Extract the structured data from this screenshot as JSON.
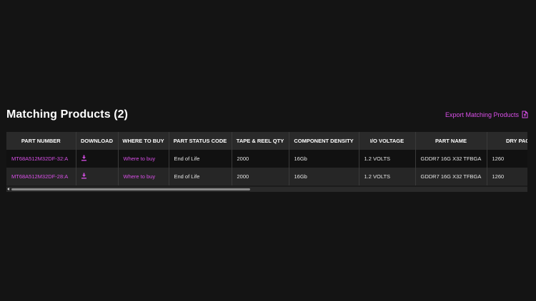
{
  "section": {
    "title": "Matching Products (2)",
    "export_label": "Export Matching Products"
  },
  "icons": {
    "export": "export-icon",
    "download": "download-icon"
  },
  "colors": {
    "background": "#141414",
    "accent": "#d94fe8",
    "header_bg": "#2a2a2a"
  },
  "table": {
    "columns": [
      "PART NUMBER",
      "DOWNLOAD",
      "WHERE TO BUY",
      "PART STATUS CODE",
      "TAPE & REEL QTY",
      "COMPONENT DENSITY",
      "I/O VOLTAGE",
      "PART NAME",
      "DRY PACK Q"
    ],
    "rows": [
      {
        "part_number": "MT68A512M32DF-32:A",
        "where_to_buy": "Where to buy",
        "status": "End of Life",
        "tape_reel_qty": "2000",
        "density": "16Gb",
        "io_voltage": "1.2 VOLTS",
        "part_name": "GDDR7 16G X32 TFBGA",
        "dry_pack_qty": "1260"
      },
      {
        "part_number": "MT68A512M32DF-28:A",
        "where_to_buy": "Where to buy",
        "status": "End of Life",
        "tape_reel_qty": "2000",
        "density": "16Gb",
        "io_voltage": "1.2 VOLTS",
        "part_name": "GDDR7 16G X32 TFBGA",
        "dry_pack_qty": "1260"
      }
    ]
  }
}
